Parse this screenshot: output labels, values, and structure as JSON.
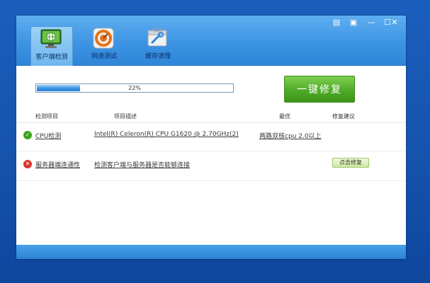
{
  "window": {
    "controls": {
      "menu": "▤",
      "skin": "▣",
      "minimize": "—",
      "maximize": "☐",
      "close": "✕"
    }
  },
  "tabs": [
    {
      "label": "客户端检测",
      "icon": "monitor-globe-icon",
      "active": true
    },
    {
      "label": "网速测试",
      "icon": "speedometer-icon",
      "active": false
    },
    {
      "label": "缓存清理",
      "icon": "toolbox-icon",
      "active": false
    }
  ],
  "progress": {
    "percent_text": "22%",
    "value": 0.22
  },
  "onekey_button": {
    "label": "一键修复"
  },
  "columns": {
    "item": "检测项目",
    "desc": "项目描述",
    "best": "最优",
    "suggestion": "修复建议"
  },
  "rows": [
    {
      "status": "ok",
      "status_glyph": "✓",
      "status_color": "#3aa51e",
      "name": "CPU检测",
      "description": "Intel(R) Celeron(R) CPU G1620 @ 2.70GHz(2)",
      "best": "两路双核cpu 2.0以上",
      "suggestion": ""
    },
    {
      "status": "error",
      "status_glyph": "✕",
      "status_color": "#d9352a",
      "name": "服务器端连通性",
      "description": "检测客户端与服务器是否能够连接",
      "best": "",
      "suggestion": "点击修复"
    }
  ],
  "colors": {
    "desktop": "#1658b6",
    "titlebar": "#3b92e2",
    "accent_green": "#4faa27",
    "statusbar": "#2d84d6"
  }
}
